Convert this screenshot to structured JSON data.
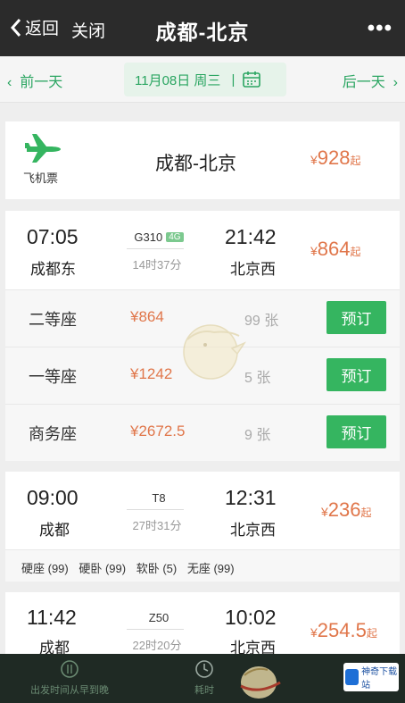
{
  "header": {
    "back_label": "返回",
    "close_label": "关闭",
    "title": "成都-北京",
    "more_label": "•••"
  },
  "datebar": {
    "prev_label": "前一天",
    "date_label": "11月08日 周三",
    "next_label": "后一天"
  },
  "flight": {
    "type_label": "飞机票",
    "route": "成都-北京",
    "currency": "¥",
    "price": "928",
    "suffix": "起"
  },
  "trains": [
    {
      "dep_time": "07:05",
      "dep_station": "成都东",
      "train_no": "G310",
      "badge": "4G",
      "duration": "14时37分",
      "arr_time": "21:42",
      "arr_station": "北京西",
      "currency": "¥",
      "price": "864",
      "suffix": "起",
      "seats": [
        {
          "name": "二等座",
          "price": "¥864",
          "count": "99 张",
          "book": "预订"
        },
        {
          "name": "一等座",
          "price": "¥1242",
          "count": "5 张",
          "book": "预订"
        },
        {
          "name": "商务座",
          "price": "¥2672.5",
          "count": "9 张",
          "book": "预订"
        }
      ]
    },
    {
      "dep_time": "09:00",
      "dep_station": "成都",
      "train_no": "T8",
      "duration": "27时31分",
      "arr_time": "12:31",
      "arr_station": "北京西",
      "currency": "¥",
      "price": "236",
      "suffix": "起",
      "availability": [
        "硬座 (99)",
        "硬卧 (99)",
        "软卧 (5)",
        "无座 (99)"
      ]
    },
    {
      "dep_time": "11:42",
      "dep_station": "成都",
      "train_no": "Z50",
      "duration": "22时20分",
      "arr_time": "10:02",
      "arr_station": "北京西",
      "currency": "¥",
      "price": "254.5",
      "suffix": "起"
    }
  ],
  "bottombar": {
    "tab1_label": "出发时间从早到晚",
    "tab2_label": "耗时"
  },
  "watermark": {
    "text": "神奇下载站"
  },
  "colors": {
    "accent_green": "#2aa561",
    "price_orange": "#e0764a",
    "button_green": "#35b560",
    "topbar": "#2b2b2b"
  }
}
